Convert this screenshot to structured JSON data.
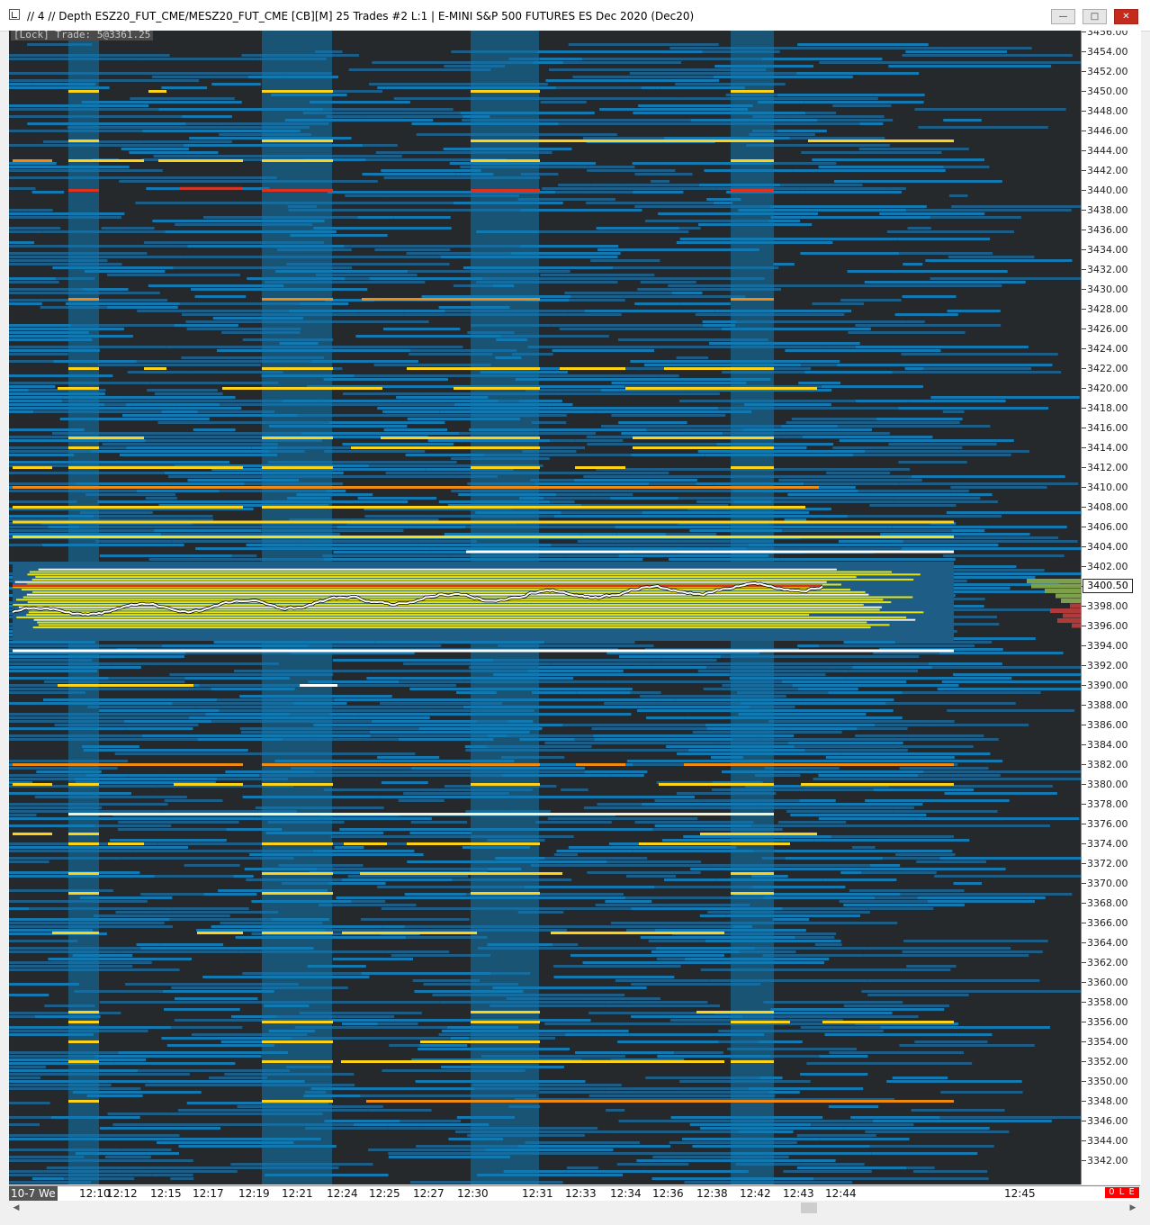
{
  "window": {
    "title": "// 4 // Depth  ESZ20_FUT_CME/MESZ20_FUT_CME [CB][M]  25 Trades  #2  L:1 | E-MINI S&P 500 FUTURES ES Dec 2020 (Dec20)",
    "minimize_glyph": "—",
    "maximize_glyph": "□",
    "close_glyph": "✕"
  },
  "chart": {
    "lock_text": "[Lock] Trade: 5@3361.25",
    "current_price": "3400.50",
    "price_labels": [
      "3456.00",
      "3454.00",
      "3452.00",
      "3450.00",
      "3448.00",
      "3446.00",
      "3444.00",
      "3442.00",
      "3440.00",
      "3438.00",
      "3436.00",
      "3434.00",
      "3432.00",
      "3430.00",
      "3428.00",
      "3426.00",
      "3424.00",
      "3422.00",
      "3420.00",
      "3418.00",
      "3416.00",
      "3414.00",
      "3412.00",
      "3410.00",
      "3408.00",
      "3406.00",
      "3404.00",
      "3402.00",
      "3400.00",
      "3398.00",
      "3396.00",
      "3394.00",
      "3392.00",
      "3390.00",
      "3388.00",
      "3386.00",
      "3384.00",
      "3382.00",
      "3380.00",
      "3378.00",
      "3376.00",
      "3374.00",
      "3372.00",
      "3370.00",
      "3368.00",
      "3366.00",
      "3364.00",
      "3362.00",
      "3360.00",
      "3358.00",
      "3356.00",
      "3354.00",
      "3352.00",
      "3350.00",
      "3348.00",
      "3346.00",
      "3344.00",
      "3342.00"
    ],
    "time_range_label": "10-7 We",
    "time_labels": [
      "12:10",
      "12:12",
      "12:15",
      "12:17",
      "12:19",
      "12:21",
      "12:24",
      "12:25",
      "12:27",
      "12:30",
      "12:31",
      "12:33",
      "12:34",
      "12:36",
      "12:38",
      "12:42",
      "12:43",
      "12:44",
      "12:45"
    ],
    "status_text": "0 L E",
    "colors": {
      "background": "#25292b",
      "liquidity_low": "#1e5d85",
      "liquidity_mid": "#1379b0",
      "liquidity_high": "#fff200",
      "large_order": "#ffd21a",
      "orange_order": "#f08a10",
      "red_order": "#e0301e",
      "price_line": "#ffffff",
      "volume_green": "#7fa04a",
      "volume_red": "#b03a3a"
    }
  },
  "scrollbar": {
    "left_glyph": "◀",
    "right_glyph": "▶"
  }
}
